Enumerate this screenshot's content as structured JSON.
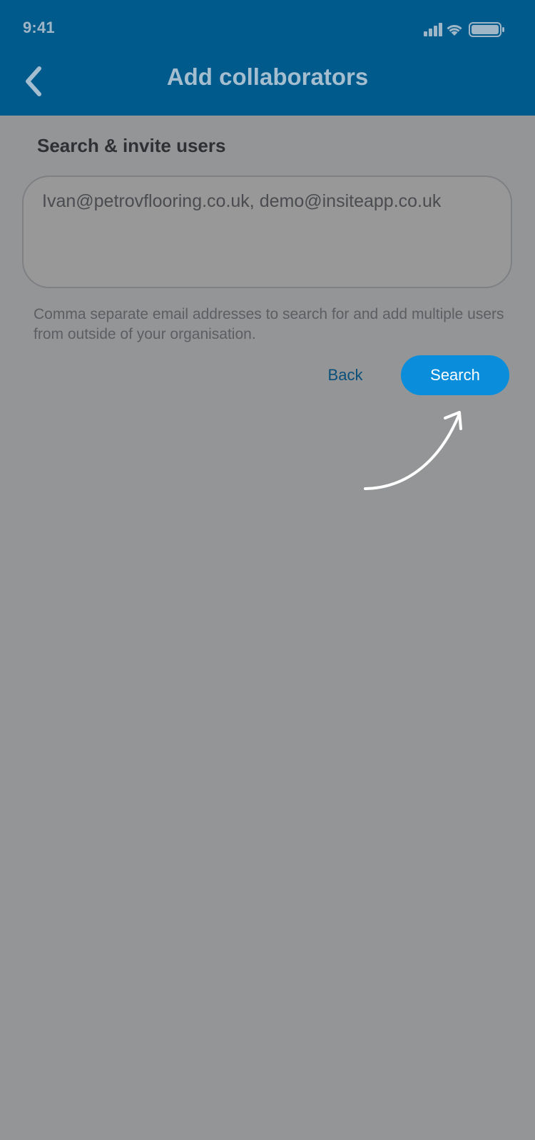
{
  "status_bar": {
    "time": "9:41",
    "icons": [
      "signal-icon",
      "wifi-icon",
      "battery-icon"
    ]
  },
  "header": {
    "title": "Add collaborators",
    "back_icon": "chevron-left-icon"
  },
  "section": {
    "heading": "Search & invite users"
  },
  "email_input": {
    "value": "Ivan@petrovflooring.co.uk, demo@insiteapp.co.uk"
  },
  "helper": {
    "text": "Comma separate email addresses to search for and add multiple users from outside of your organisation."
  },
  "actions": {
    "back_label": "Back",
    "search_label": "Search"
  },
  "colors": {
    "header_bg": "#005A8C",
    "overlay_bg": "#949596",
    "primary_button": "#0A8EDB",
    "link": "#0A4F7A"
  }
}
